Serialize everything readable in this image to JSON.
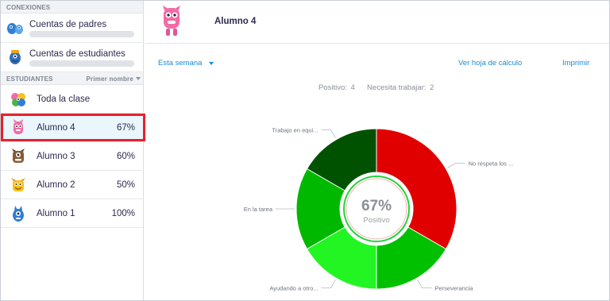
{
  "sidebar": {
    "connections_header": "CONEXIONES",
    "connections": [
      {
        "label": "Cuentas de padres",
        "icon": "parent-monster-icon"
      },
      {
        "label": "Cuentas de estudiantes",
        "icon": "student-monster-icon"
      }
    ],
    "students_header": "ESTUDIANTES",
    "sort_label": "Primer nombre",
    "whole_class": "Toda la clase",
    "students": [
      {
        "name": "Alumno 4",
        "pct": "67%",
        "selected": true,
        "color": "#f26ba6"
      },
      {
        "name": "Alumno 3",
        "pct": "60%",
        "selected": false,
        "color": "#8a5a34"
      },
      {
        "name": "Alumno 2",
        "pct": "50%",
        "selected": false,
        "color": "#f5c21b"
      },
      {
        "name": "Alumno 1",
        "pct": "100%",
        "selected": false,
        "color": "#2f7fd6"
      }
    ]
  },
  "header": {
    "title": "Alumno 4"
  },
  "toolbar": {
    "range": "Esta semana",
    "sheet_link": "Ver hoja de cálculo",
    "print_link": "Imprimir"
  },
  "summary": {
    "positive_label": "Positivo:",
    "positive_value": "4",
    "needs_work_label": "Necesita trabajar:",
    "needs_work_value": "2"
  },
  "chart_data": {
    "type": "pie",
    "center_value": "67%",
    "center_label": "Positivo",
    "slices": [
      {
        "label": "No respeta los ...",
        "value": 2,
        "color": "#e00000"
      },
      {
        "label": "Perseverancia",
        "value": 1,
        "color": "#00c000"
      },
      {
        "label": "Ayudando a otro...",
        "value": 1,
        "color": "#22f522"
      },
      {
        "label": "En la tarea",
        "value": 1,
        "color": "#00b800"
      },
      {
        "label": "Trabajo en equi...",
        "value": 1,
        "color": "#005200"
      }
    ]
  }
}
